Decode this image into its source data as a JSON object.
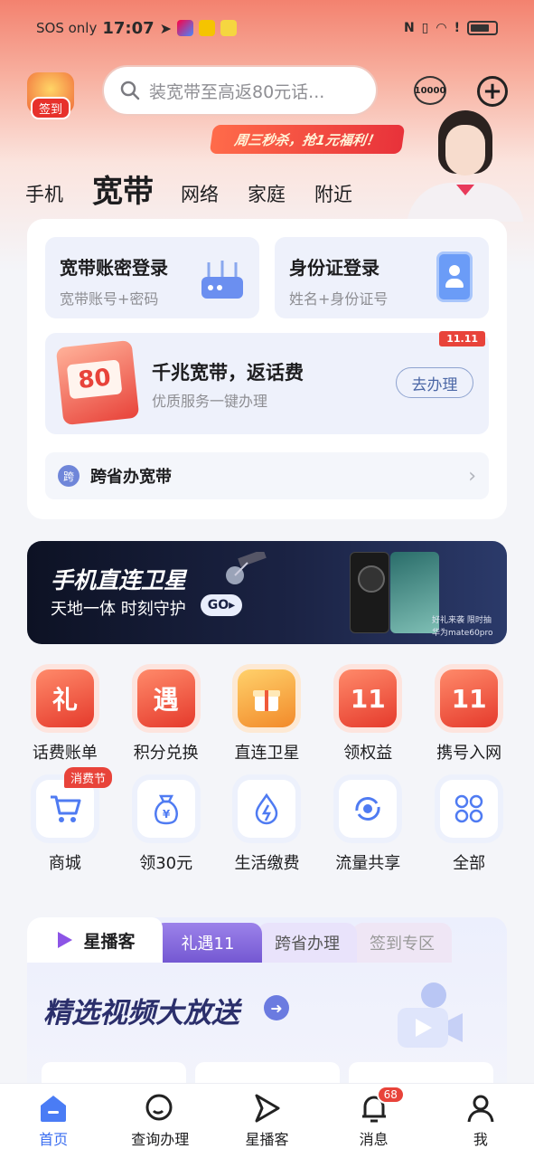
{
  "status_bar": {
    "carrier": "SOS only",
    "time": "17:07",
    "signal_text": "NFC  vibrate  wifi  !"
  },
  "header": {
    "signin_label": "签到",
    "search_placeholder": "装宽带至高返80元话...",
    "service_icon_label": "10000",
    "add_icon": "plus-icon",
    "promo_text": "周三秒杀，抢1元福利！"
  },
  "category_tabs": [
    {
      "label": "手机",
      "active": false
    },
    {
      "label": "宽带",
      "active": true
    },
    {
      "label": "网络",
      "active": false
    },
    {
      "label": "家庭",
      "active": false
    },
    {
      "label": "附近",
      "active": false
    }
  ],
  "broadband_card": {
    "account_login": {
      "title": "宽带账密登录",
      "subtitle": "宽带账号+密码"
    },
    "id_login": {
      "title": "身份证登录",
      "subtitle": "姓名+身份证号"
    },
    "gig_offer": {
      "redpack_value": "80",
      "title": "千兆宽带，返话费",
      "subtitle": "优质服务一键办理",
      "button": "去办理",
      "tag": "11.11"
    },
    "cross_province": {
      "label": "跨省办宽带",
      "icon_text": "跨"
    }
  },
  "satellite_banner": {
    "title": "手机直连卫星",
    "subtitle": "天地一体 时刻守护",
    "go": "GO▸",
    "caption1": "好礼来袭 限时抽",
    "caption2": "华为mate60pro"
  },
  "quick_grid": [
    {
      "label": "话费账单",
      "icon": "礼",
      "style": "red"
    },
    {
      "label": "积分兑换",
      "icon": "遇",
      "style": "red"
    },
    {
      "label": "直连卫星",
      "icon": "🎁",
      "style": "gold"
    },
    {
      "label": "领权益",
      "icon": "11",
      "style": "red"
    },
    {
      "label": "携号入网",
      "icon": "11",
      "style": "red"
    },
    {
      "label": "商城",
      "icon": "cart-icon",
      "style": "blue",
      "badge": "消费节"
    },
    {
      "label": "领30元",
      "icon": "money-bag-icon",
      "style": "blue"
    },
    {
      "label": "生活缴费",
      "icon": "utility-icon",
      "style": "blue"
    },
    {
      "label": "流量共享",
      "icon": "share-icon",
      "style": "blue"
    },
    {
      "label": "全部",
      "icon": "grid-icon",
      "style": "blue"
    }
  ],
  "feed": {
    "brand": "星播客",
    "tabs": [
      "礼遇11",
      "跨省办理",
      "签到专区"
    ],
    "headline": "精选视频大放送"
  },
  "bottom_nav": [
    {
      "label": "首页",
      "icon": "home-icon",
      "active": true
    },
    {
      "label": "查询办理",
      "icon": "query-icon",
      "active": false
    },
    {
      "label": "星播客",
      "icon": "play-icon",
      "active": false
    },
    {
      "label": "消息",
      "icon": "bell-icon",
      "active": false,
      "badge": "68"
    },
    {
      "label": "我",
      "icon": "profile-icon",
      "active": false
    }
  ],
  "colors": {
    "accent_blue": "#3a6df0",
    "brand_red": "#e8433a",
    "feed_purple": "#7458d2"
  }
}
